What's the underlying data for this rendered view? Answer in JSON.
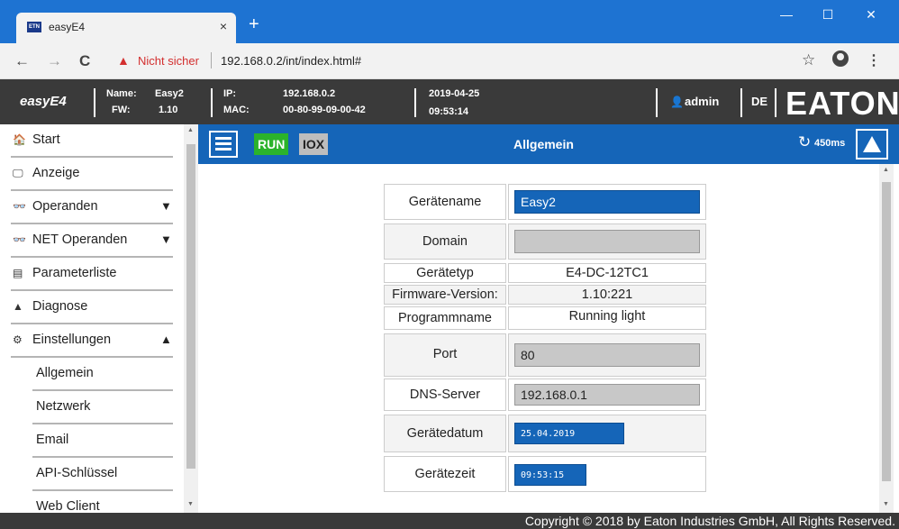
{
  "browser": {
    "tab_title": "easyE4",
    "tab_close": "×",
    "new_tab": "+",
    "win_min": "—",
    "win_max": "☐",
    "win_close": "✕",
    "back": "←",
    "forward": "→",
    "reload": "C",
    "security_warning": "Nicht sicher",
    "url": "192.168.0.2/int/index.html#",
    "menu": "⋮",
    "star": "☆"
  },
  "header": {
    "brand": "easyE4",
    "name_label": "Name:",
    "name_value": "Easy2",
    "fw_label": "FW:",
    "fw_value": "1.10",
    "ip_label": "IP:",
    "ip_value": "192.168.0.2",
    "mac_label": "MAC:",
    "mac_value": "00-80-99-09-00-42",
    "date": "2019-04-25",
    "time": "09:53:14",
    "user": "admin",
    "language": "DE",
    "logo": "EATON"
  },
  "sidebar": {
    "items": [
      {
        "label": "Start",
        "icon": "home-icon"
      },
      {
        "label": "Anzeige",
        "icon": "monitor-icon"
      },
      {
        "label": "Operanden",
        "icon": "glasses-icon",
        "arrow": "▼"
      },
      {
        "label": "NET Operanden",
        "icon": "glasses-icon",
        "arrow": "▼"
      },
      {
        "label": "Parameterliste",
        "icon": "list-icon"
      },
      {
        "label": "Diagnose",
        "icon": "warning-icon"
      },
      {
        "label": "Einstellungen",
        "icon": "gear-icon",
        "arrow": "▲"
      }
    ],
    "subitems": [
      {
        "label": "Allgemein"
      },
      {
        "label": "Netzwerk"
      },
      {
        "label": "Email"
      },
      {
        "label": "API-Schlüssel"
      },
      {
        "label": "Web Client"
      }
    ]
  },
  "toolbar": {
    "run": "RUN",
    "iox": "IOX",
    "title": "Allgemein",
    "refresh": "450ms"
  },
  "form": {
    "device_name_label": "Gerätename",
    "device_name_value": "Easy2",
    "domain_label": "Domain",
    "domain_value": "",
    "device_type_label": "Gerätetyp",
    "device_type_value": "E4-DC-12TC1",
    "firmware_label": "Firmware-Version:",
    "firmware_value": "1.10:221",
    "program_label": "Programmname",
    "program_value": "Running light",
    "port_label": "Port",
    "port_value": "80",
    "dns_label": "DNS-Server",
    "dns_value": "192.168.0.1",
    "date_label": "Gerätedatum",
    "date_value": "25.04.2019",
    "time_label": "Gerätezeit",
    "time_value": "09:53:15"
  },
  "footer": {
    "text": "Copyright © 2018 by Eaton Industries GmbH, All Rights Reserved."
  },
  "colors": {
    "accent": "#1565b8",
    "run": "#2bb32b",
    "header": "#3a3a3a",
    "titlebar": "#1e73d2"
  }
}
